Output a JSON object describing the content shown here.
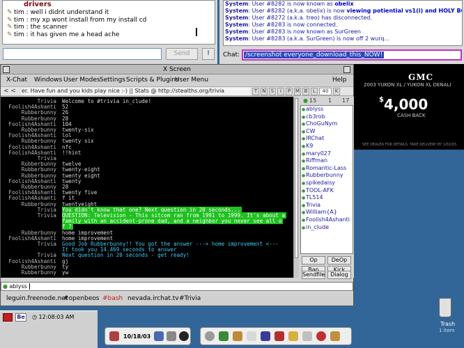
{
  "top_chat": {
    "header": "drivers",
    "lines": [
      {
        "nick": "tim",
        "text": "well i didnt understand it"
      },
      {
        "nick": "tim",
        "text": "my xp wont install from my install cd"
      },
      {
        "nick": "tim",
        "text": "the scanner"
      },
      {
        "nick": "tim",
        "text": "it has given me a head ache"
      }
    ],
    "send_label": "Send",
    "bang_label": "!"
  },
  "system_log": {
    "lines": [
      {
        "prefix": "System",
        "text": "User #8282 is now known as ",
        "emph": "obelix"
      },
      {
        "prefix": "System",
        "text": "User #8282 (a.k.a. obelix) is now ",
        "emph": "viewing potiential vs1(i)",
        "tail": " and HOLY BOVINE!"
      },
      {
        "prefix": "System",
        "text": "User #8272 (a.k.a. treo) has disconnected.",
        "emph": "",
        "tail": ""
      },
      {
        "prefix": "System",
        "text": "User #8283 is now connected.",
        "emph": "",
        "tail": ""
      },
      {
        "prefix": "System",
        "text": "User #8283 is now known as SurGreen",
        "emph": "",
        "tail": ""
      },
      {
        "prefix": "System",
        "text": "User #8283 (a.k.a. SurGreen) is now off 2 wurq...",
        "emph": "",
        "tail": ""
      }
    ],
    "chat_label": "Chat:",
    "chat_value": "/screenshot everyone_download_this_NOW!"
  },
  "ad": {
    "brand": "GMC",
    "model": "2003 YUKON XL / YUKON XL DENALI",
    "price": "4,000",
    "price_symbol": "$",
    "subtext": "CASH BACK",
    "fine_print": "SEE DEALER FOR DETAILS. TAKE DELIVERY BY 1/02/03."
  },
  "xchat": {
    "title": "X Screen",
    "menu": [
      "X-Chat",
      "Windows",
      "User Modes",
      "Settings",
      "Scripts & Plugins",
      "User Menu",
      "Help"
    ],
    "topic_arrows": "< <",
    "topic": "er. Have fun and you kids play nice :-) || Stats @ http://stealths.org/trivia",
    "mode_buttons": [
      "T",
      "N",
      "S",
      "I",
      "P",
      "M",
      "B",
      "L"
    ],
    "limit": "40",
    "key_btn": "K",
    "messages": [
      {
        "nick": "Trivia",
        "text": "Welcome to #trivia in_clude!",
        "style": ""
      },
      {
        "nick": "Foolish4Ashanti",
        "text": "52",
        "style": ""
      },
      {
        "nick": "Rubberbunny",
        "text": "26",
        "style": ""
      },
      {
        "nick": "Rubberbunny",
        "text": "28",
        "style": ""
      },
      {
        "nick": "Foolish4Ashanti",
        "text": "104",
        "style": ""
      },
      {
        "nick": "Rubberbunny",
        "text": "twenty-six",
        "style": ""
      },
      {
        "nick": "Foolish4Ashanti",
        "text": "lol",
        "style": ""
      },
      {
        "nick": "Rubberbunny",
        "text": "twenty six",
        "style": ""
      },
      {
        "nick": "Foolish4Ashanti",
        "text": "nfc",
        "style": ""
      },
      {
        "nick": "Foolish4Ashanti",
        "text": "!!hint",
        "style": ""
      },
      {
        "nick": "Trivia",
        "text": "",
        "style": ""
      },
      {
        "nick": "Rubberbunny",
        "text": "twelve",
        "style": ""
      },
      {
        "nick": "Rubberbunny",
        "text": "twenty-eight",
        "style": ""
      },
      {
        "nick": "Rubberbunny",
        "text": "twenty eight",
        "style": ""
      },
      {
        "nick": "Foolish4Ashanti",
        "text": "twenty",
        "style": ""
      },
      {
        "nick": "Rubberbunny",
        "text": "28",
        "style": ""
      },
      {
        "nick": "Foolish4Ashanti",
        "text": "twenty five",
        "style": ""
      },
      {
        "nick": "Foolish4Ashanti",
        "text": "f it",
        "style": ""
      },
      {
        "nick": "Rubberbunny",
        "text": "twentyeight",
        "style": ""
      },
      {
        "nick": "Trivia",
        "text": "You didn't know that one? Next question in 20 seconds...",
        "style": "g"
      },
      {
        "nick": "Trivia",
        "text": "QUESTION: Television - This sitcom ran from 1991 to 1999. It's about a",
        "style": "g"
      },
      {
        "nick": "",
        "text": " family with an accident-prone dad, and a neighbor you never see all o",
        "style": "g"
      },
      {
        "nick": "",
        "text": "f ?",
        "style": "g"
      },
      {
        "nick": "Rubberbunny",
        "text": "home improvement",
        "style": ""
      },
      {
        "nick": "Foolish4Ashanti",
        "text": "home improvement",
        "style": ""
      },
      {
        "nick": "Trivia",
        "text": "Good Job Rubberbunny!! You got the answer ---> home improvement <---",
        "style": "c"
      },
      {
        "nick": "",
        "text": "It took you 14.469 seconds to answer",
        "style": "c"
      },
      {
        "nick": "Trivia",
        "text": "Next question in 20 seconds - get ready!",
        "style": "c"
      },
      {
        "nick": "Foolish4Ashanti",
        "text": "gj",
        "style": ""
      },
      {
        "nick": "Rubberbunny",
        "text": "ty",
        "style": ""
      },
      {
        "nick": "Rubberbunny",
        "text": "yw",
        "style": ""
      }
    ],
    "ops_count": "15",
    "ops_sep": "1",
    "user_count": "17",
    "users": [
      "ablyss",
      "cb3rob",
      "ChoGuNym",
      "CW",
      "IRChat",
      "K9",
      "mary027",
      "Riffman",
      "Romantic-Lass",
      "Rubberbunny",
      "spikedaisy",
      "TOOL-AFK",
      "TL514",
      "Trivia",
      "William{A}",
      "Foolish4Ashanti",
      "in_clude"
    ],
    "user_buttons": [
      "Op",
      "DeOp",
      "Ban",
      "Kick",
      "Sendfile",
      "Dialog"
    ],
    "input_nick": "ablyss",
    "tabs": [
      "leguin.freenode.net",
      "#openbeos",
      "#bash",
      "nevada.irchat.tv",
      "#Trivia"
    ]
  },
  "desktop": {
    "be_label": "Be",
    "time": "12:08:03 AM",
    "date": "10/18/03",
    "trash_label": "Trash",
    "trash_count": "1 item"
  },
  "colors": {
    "desktop": "#336698",
    "trivia_green": "#20c020",
    "trivia_cyan": "#40c8f0",
    "link_blue": "#1a1aa0",
    "header_red": "#7a0d0d"
  }
}
